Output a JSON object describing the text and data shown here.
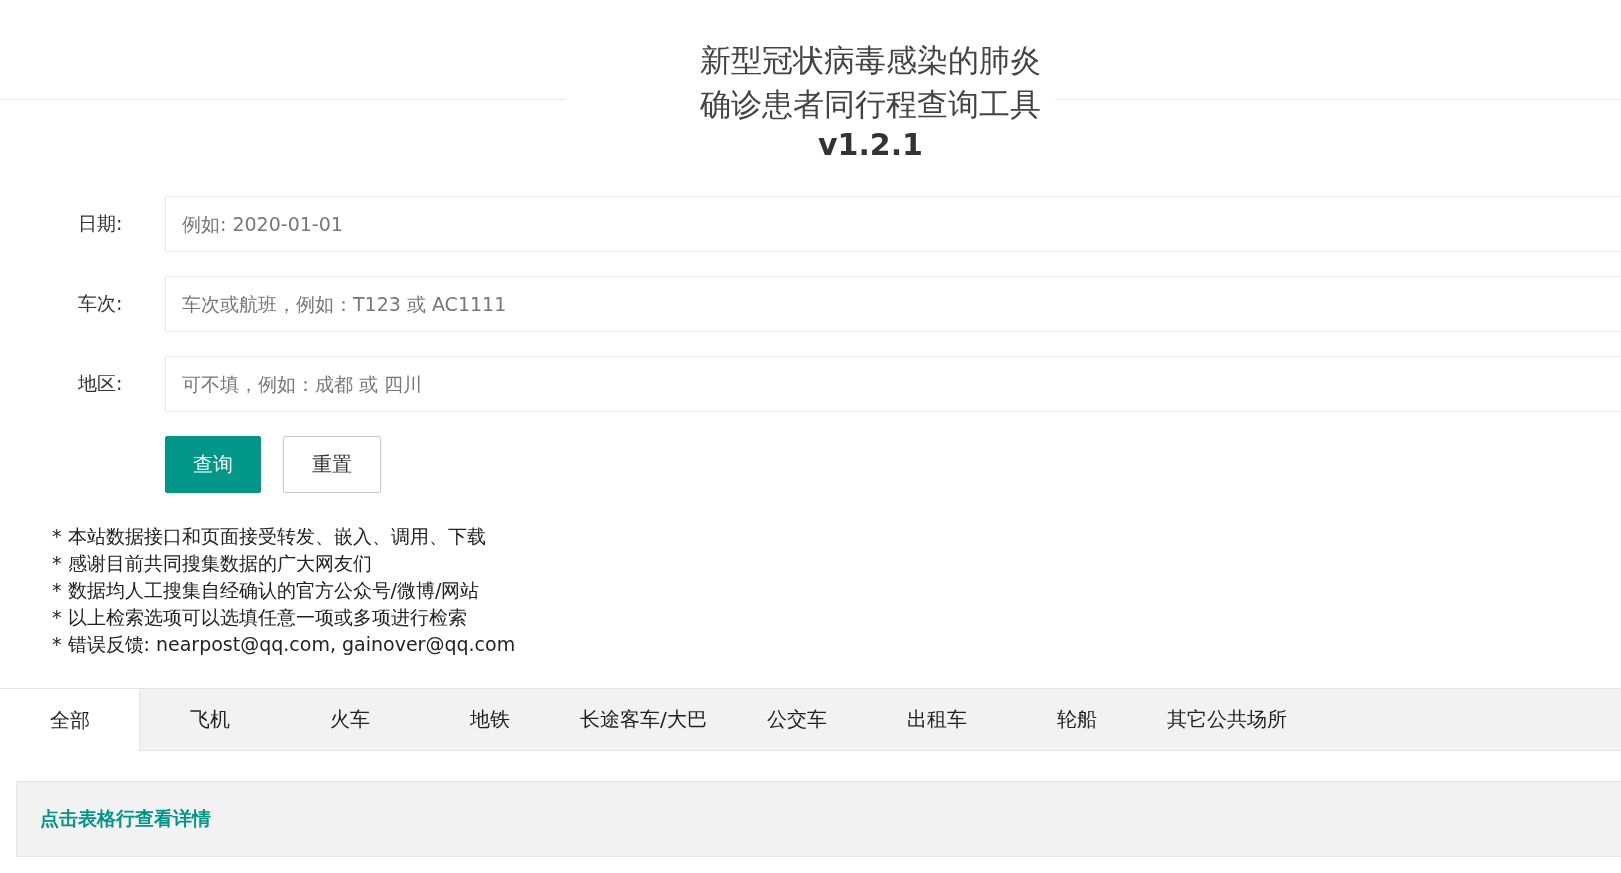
{
  "header": {
    "title_lines": [
      "新型冠状病毒感染的肺炎",
      "确诊患者同行程查询工具"
    ],
    "version": "v1.2.1"
  },
  "form": {
    "fields": [
      {
        "label": "日期:",
        "placeholder": "例如: 2020-01-01"
      },
      {
        "label": "车次:",
        "placeholder": "车次或航班，例如：T123 或 AC1111"
      },
      {
        "label": "地区:",
        "placeholder": "可不填，例如：成都 或 四川"
      }
    ],
    "buttons": [
      {
        "label": "查询",
        "kind": "primary"
      },
      {
        "label": "重置",
        "kind": "secondary"
      }
    ]
  },
  "notes": [
    "* 本站数据接口和页面接受转发、嵌入、调用、下载",
    "* 感谢目前共同搜集数据的广大网友们",
    "* 数据均人工搜集自经确认的官方公众号/微博/网站",
    "* 以上检索选项可以选填任意一项或多项进行检索",
    "* 错误反馈: nearpost@qq.com, gainover@qq.com"
  ],
  "tabs": [
    {
      "label": "全部",
      "selected": true
    },
    {
      "label": "飞机",
      "selected": false
    },
    {
      "label": "火车",
      "selected": false
    },
    {
      "label": "地铁",
      "selected": false
    },
    {
      "label": "长途客车/大巴",
      "selected": false
    },
    {
      "label": "公交车",
      "selected": false
    },
    {
      "label": "出租车",
      "selected": false
    },
    {
      "label": "轮船",
      "selected": false
    },
    {
      "label": "其它公共场所",
      "selected": false
    }
  ],
  "panel": {
    "heading": "点击表格行查看详情"
  }
}
